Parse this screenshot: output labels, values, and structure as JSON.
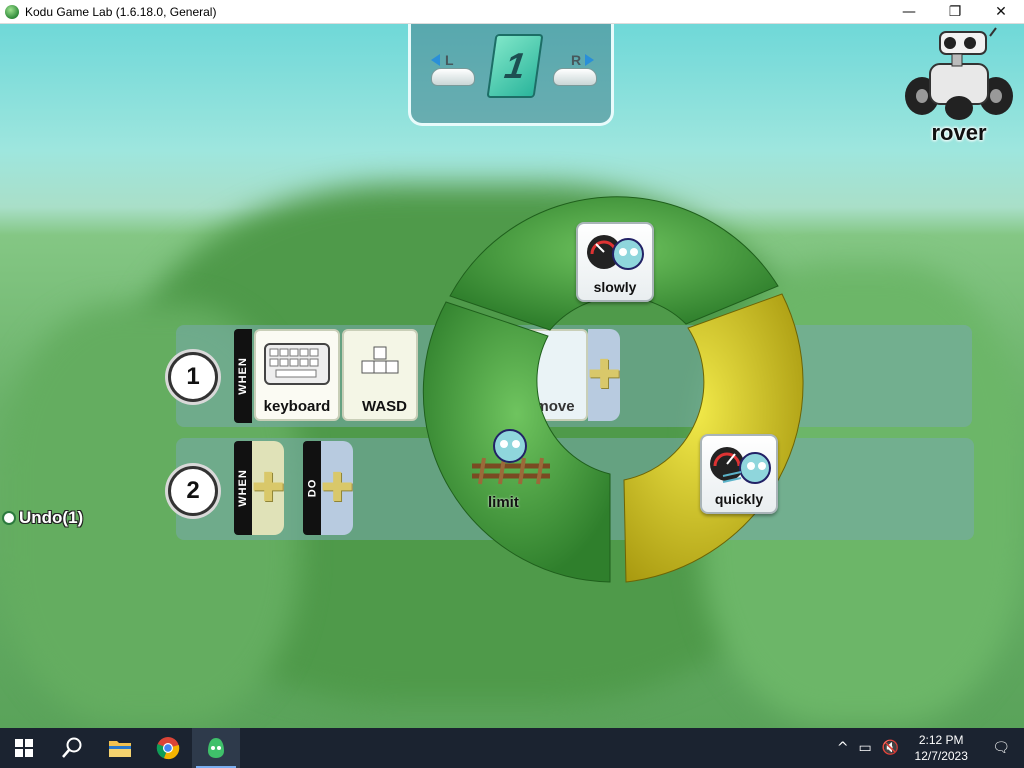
{
  "window": {
    "title": "Kodu Game Lab (1.6.18.0, General)",
    "minimize": "—",
    "maximize": "❐",
    "close": "✕"
  },
  "pager": {
    "left_shoulder": "L",
    "right_shoulder": "R",
    "page_number": "1"
  },
  "character": {
    "name": "rover"
  },
  "rules": [
    {
      "number": "1",
      "when_tag": "WHEN",
      "tiles": [
        "keyboard",
        "WASD"
      ],
      "do_tiles": [
        "move"
      ]
    },
    {
      "number": "2",
      "when_tag": "WHEN",
      "do_tag": "DO"
    }
  ],
  "pie_menu": {
    "items": [
      {
        "label": "slowly",
        "highlighted": false
      },
      {
        "label": "quickly",
        "highlighted": true
      },
      {
        "label": "limit",
        "highlighted": false
      }
    ],
    "colors": {
      "segment": "#3f9a3a",
      "selected": "#d9cf1c"
    }
  },
  "undo": {
    "label": "Undo(1)"
  },
  "taskbar": {
    "pinned": [
      "windows-start",
      "search",
      "file-explorer",
      "chrome",
      "kodu-game-lab"
    ],
    "clock_time": "2:12 PM",
    "clock_date": "12/7/2023"
  }
}
